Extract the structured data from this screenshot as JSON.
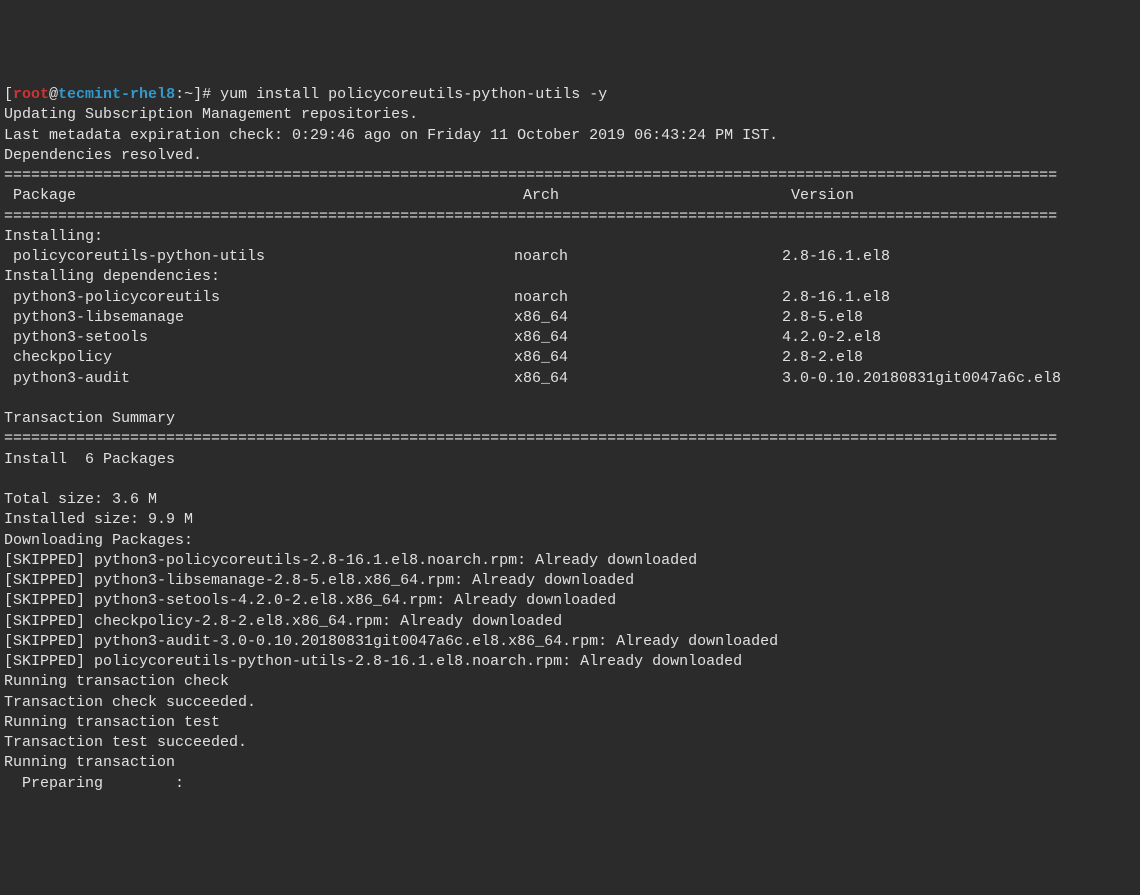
{
  "prompt": {
    "open": "[",
    "user": "root",
    "at": "@",
    "host": "tecmint-rhel8",
    "colon": ":",
    "path": "~",
    "close": "]",
    "hash": "#"
  },
  "command": "yum install policycoreutils-python-utils -y",
  "lines": {
    "updating": "Updating Subscription Management repositories.",
    "metadata": "Last metadata expiration check: 0:29:46 ago on Friday 11 October 2019 06:43:24 PM IST.",
    "depsresolved": "Dependencies resolved."
  },
  "divider": "=====================================================================================================================",
  "header": {
    "package": "Package",
    "arch": "Arch",
    "version": "Version"
  },
  "installing_label": "Installing:",
  "installing_deps_label": "Installing dependencies:",
  "packages": [
    {
      "name": " policycoreutils-python-utils",
      "arch": "noarch",
      "version": "2.8-16.1.el8"
    }
  ],
  "deps": [
    {
      "name": " python3-policycoreutils",
      "arch": "noarch",
      "version": "2.8-16.1.el8"
    },
    {
      "name": " python3-libsemanage",
      "arch": "x86_64",
      "version": "2.8-5.el8"
    },
    {
      "name": " python3-setools",
      "arch": "x86_64",
      "version": "4.2.0-2.el8"
    },
    {
      "name": " checkpolicy",
      "arch": "x86_64",
      "version": "2.8-2.el8"
    },
    {
      "name": " python3-audit",
      "arch": "x86_64",
      "version": "3.0-0.10.20180831git0047a6c.el8"
    }
  ],
  "summary": {
    "blank": "",
    "title": "Transaction Summary",
    "install": "Install  6 Packages",
    "totalsize": "Total size: 3.6 M",
    "installedsize": "Installed size: 9.9 M",
    "downloading": "Downloading Packages:"
  },
  "skipped": [
    "[SKIPPED] python3-policycoreutils-2.8-16.1.el8.noarch.rpm: Already downloaded",
    "[SKIPPED] python3-libsemanage-2.8-5.el8.x86_64.rpm: Already downloaded",
    "[SKIPPED] python3-setools-4.2.0-2.el8.x86_64.rpm: Already downloaded",
    "[SKIPPED] checkpolicy-2.8-2.el8.x86_64.rpm: Already downloaded",
    "[SKIPPED] python3-audit-3.0-0.10.20180831git0047a6c.el8.x86_64.rpm: Already downloaded",
    "[SKIPPED] policycoreutils-python-utils-2.8-16.1.el8.noarch.rpm: Already downloaded"
  ],
  "transaction": [
    "Running transaction check",
    "Transaction check succeeded.",
    "Running transaction test",
    "Transaction test succeeded.",
    "Running transaction",
    "  Preparing        :"
  ]
}
